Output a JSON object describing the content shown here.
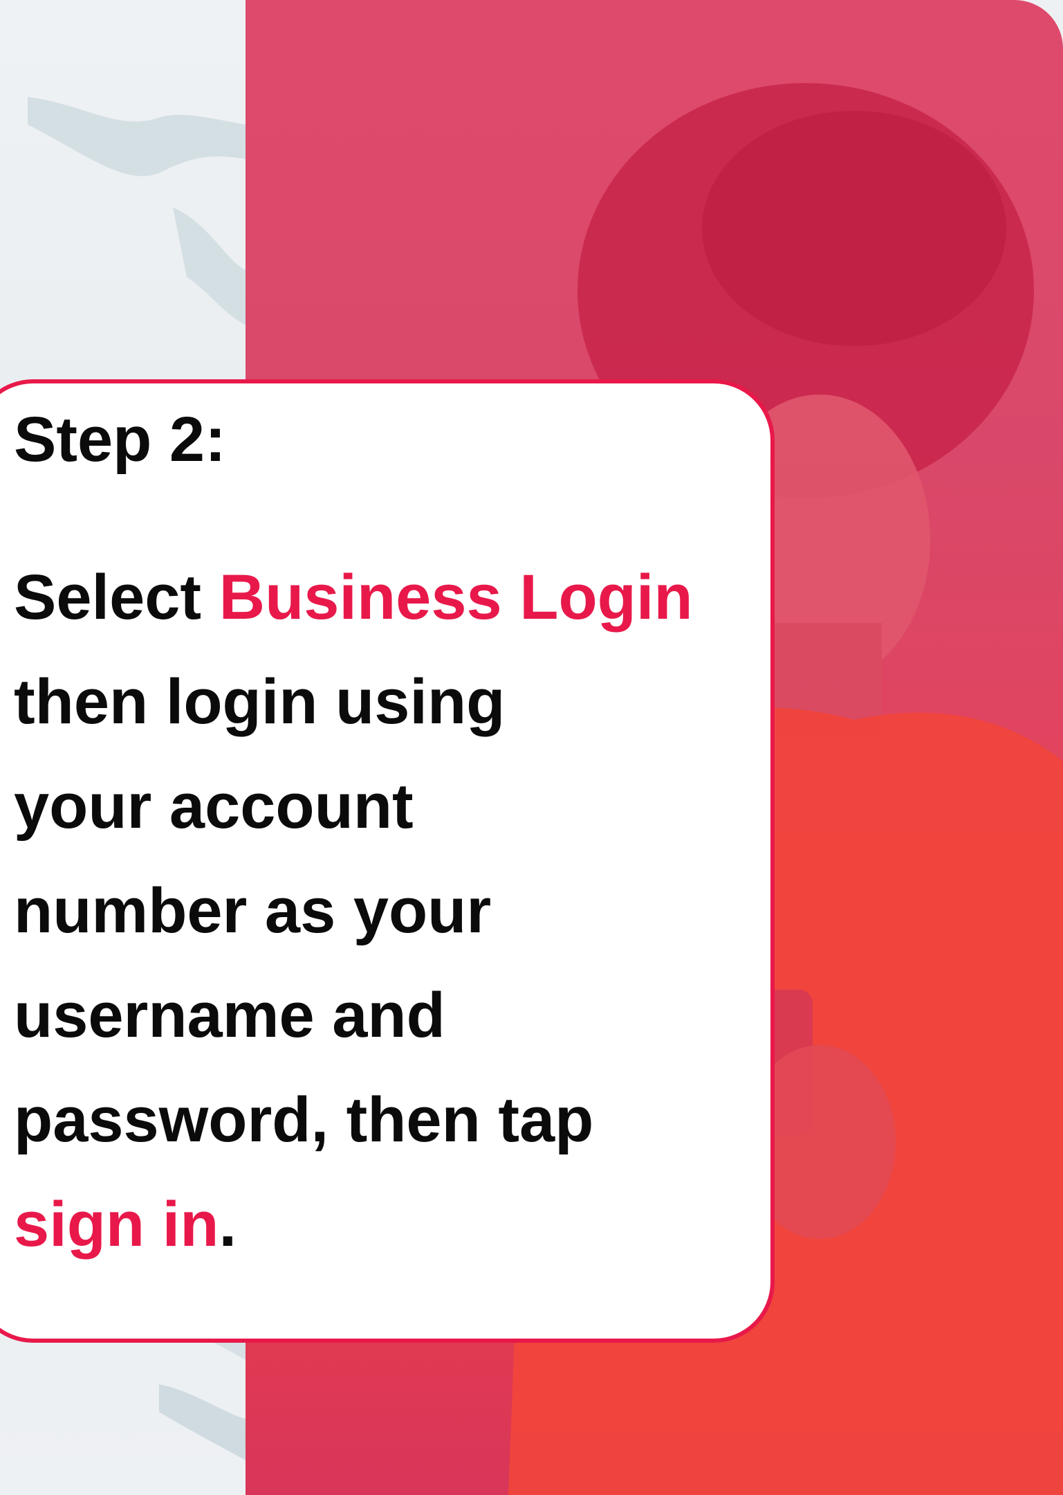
{
  "step": {
    "title": "Step 2:"
  },
  "instructions": {
    "part1": "Select ",
    "highlight1": "Business Login",
    "line2": "then login using",
    "line3": "your account",
    "line4": "number as your",
    "line5": "username and",
    "line6": "password, then tap",
    "highlight2": "sign in",
    "end": "."
  },
  "colors": {
    "accent": "#e8194a",
    "text": "#0b0b0b",
    "background_overlay": "#de4a6c",
    "left_panel": "#eef1f3"
  },
  "images": {
    "background": "person-photo"
  }
}
